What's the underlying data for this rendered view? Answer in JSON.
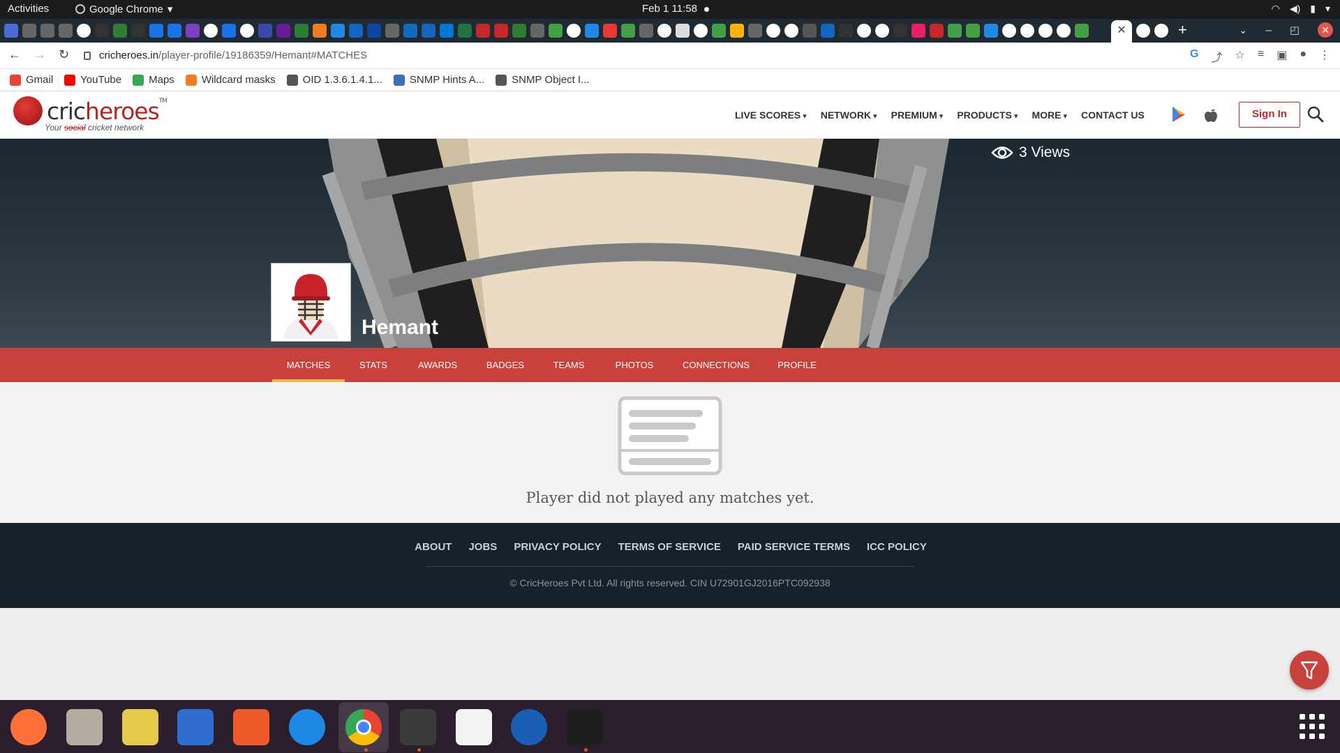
{
  "system": {
    "activities": "Activities",
    "app_name": "Google Chrome",
    "clock": "Feb 1  11:58"
  },
  "browser": {
    "url_host": "cricheroes.in",
    "url_path": "/player-profile/19186359/Hemant#MATCHES",
    "active_tab_close": "✕",
    "new_tab": "+"
  },
  "bookmarks": [
    {
      "label": "Gmail",
      "color": "#ea4335"
    },
    {
      "label": "YouTube",
      "color": "#ff0000"
    },
    {
      "label": "Maps",
      "color": "#34a853"
    },
    {
      "label": "Wildcard masks",
      "color": "#f47b20"
    },
    {
      "label": "OID 1.3.6.1.4.1...",
      "color": "#555555"
    },
    {
      "label": "SNMP Hints A...",
      "color": "#3b6fb6"
    },
    {
      "label": "SNMP Object I...",
      "color": "#555555"
    }
  ],
  "site": {
    "logo_cric": "cric",
    "logo_heroes": "heroes",
    "logo_tm": "TM",
    "tagline_pre": "Your ",
    "tagline_strike": "social",
    "tagline_post": " cricket network",
    "menu": [
      {
        "label": "LIVE SCORES",
        "dropdown": true
      },
      {
        "label": "NETWORK",
        "dropdown": true
      },
      {
        "label": "PREMIUM",
        "dropdown": true
      },
      {
        "label": "PRODUCTS",
        "dropdown": true
      },
      {
        "label": "MORE",
        "dropdown": true
      },
      {
        "label": "CONTACT US",
        "dropdown": false
      }
    ],
    "signin": "Sign In",
    "brand_color": "#c8413a"
  },
  "profile": {
    "views": "3 Views",
    "name": "Hemant",
    "tabs": [
      "MATCHES",
      "STATS",
      "AWARDS",
      "BADGES",
      "TEAMS",
      "PHOTOS",
      "CONNECTIONS",
      "PROFILE"
    ],
    "active_tab": "MATCHES",
    "empty_message": "Player did not played any matches yet."
  },
  "footer": {
    "links": [
      "ABOUT",
      "JOBS",
      "PRIVACY POLICY",
      "TERMS OF SERVICE",
      "PAID SERVICE TERMS",
      "ICC POLICY"
    ],
    "copyright": "© CricHeroes Pvt Ltd. All rights reserved. CIN U72901GJ2016PTC092938"
  },
  "dock": [
    "firefox-icon",
    "files-icon",
    "rhythmbox-icon",
    "writer-icon",
    "app-center-icon",
    "help-icon",
    "chrome-icon",
    "terminal-icon",
    "text-editor-icon",
    "thunderbird-icon",
    "intellij-icon"
  ]
}
